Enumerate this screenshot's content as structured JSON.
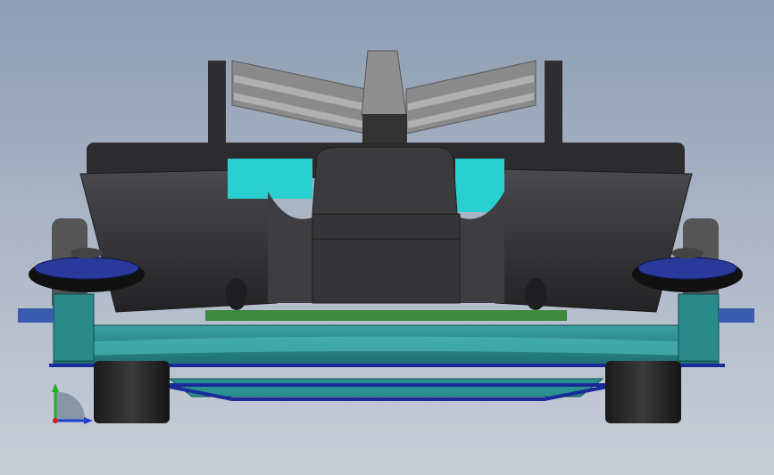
{
  "viewport": {
    "background_top": "#8d9db3",
    "background_bottom": "#c8ced8"
  },
  "model": {
    "body_color": "#3a3a3c",
    "wing_color": "#8f8f8f",
    "chassis_color": "#2a8a8a",
    "rail_color": "#1a2a9a",
    "accent_color": "#2ad0d0",
    "roller_color": "#2a3a9a"
  },
  "triad": {
    "icon": "axis-triad-icon",
    "x_color": "#d02020",
    "y_color": "#20b020",
    "z_color": "#2040d0"
  }
}
